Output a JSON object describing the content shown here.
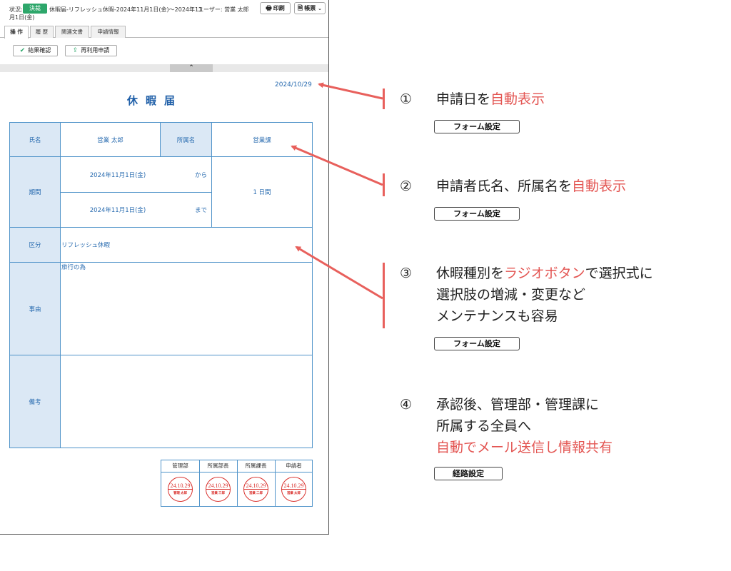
{
  "header": {
    "status_label": "状況:",
    "status_badge": "決裁",
    "subject_line1": "休暇届-リフレッシュ休暇-2024年11月1日(金)〜2024年11",
    "subject_line2": "月1日(金)",
    "user": "ユーザー: 営業 太郎",
    "print_label": "印刷",
    "forms_label": "帳票",
    "print_icon": "printer-icon",
    "forms_icon": "document-icon"
  },
  "tabs": [
    {
      "label": "操 作",
      "active": true
    },
    {
      "label": "履 歴",
      "active": false
    },
    {
      "label": "関連文書",
      "active": false
    },
    {
      "label": "申請情報",
      "active": false
    }
  ],
  "actions": {
    "confirm_label": "結果確認",
    "reapply_label": "再利用申請"
  },
  "form": {
    "date": "2024/10/29",
    "title": "休暇届",
    "name_label": "氏名",
    "name_value": "営業 太郎",
    "dept_label": "所属名",
    "dept_value": "営業課",
    "period_label": "期間",
    "from_date": "2024年11月1日(金)",
    "from_suffix": "から",
    "to_date": "2024年11月1日(金)",
    "to_suffix": "まで",
    "days": "1 日間",
    "type_label": "区分",
    "type_value": "リフレッシュ休暇",
    "reason_label": "事由",
    "reason_value": "旅行の為",
    "notes_label": "備考",
    "notes_value": ""
  },
  "stamps": [
    {
      "header": "管理部",
      "date": "24.10.29",
      "name": "管理 太郎"
    },
    {
      "header": "所属部長",
      "date": "24.10.29",
      "name": "営業 三郎"
    },
    {
      "header": "所属課長",
      "date": "24.10.29",
      "name": "営業 二郎"
    },
    {
      "header": "申請者",
      "date": "24.10.29",
      "name": "営業 太郎"
    }
  ],
  "annotations": [
    {
      "num": "①",
      "lines": [
        [
          "申請日を",
          ""
        ],
        [
          "",
          "自動表示"
        ]
      ],
      "button": "フォーム設定"
    },
    {
      "num": "②",
      "lines": [
        [
          "申請者氏名、所属名を",
          ""
        ],
        [
          "",
          "自動表示"
        ]
      ],
      "button": "フォーム設定"
    },
    {
      "num": "③",
      "parts": [
        "休暇種別を",
        "ラジオボタン",
        "で選択式に"
      ],
      "line2": "選択肢の増減・変更など",
      "line3": "メンテナンスも容易",
      "button": "フォーム設定"
    },
    {
      "num": "④",
      "line1": "承認後、管理部・管理課に",
      "line2": "所属する全員へ",
      "line3": "自動でメール送信し情報共有",
      "button": "経路設定"
    }
  ],
  "colors": {
    "accent": "#1f5fa8",
    "grid": "#4f93c9",
    "label_bg": "#dbe8f5",
    "badge": "#2ea76b",
    "highlight": "#e35552",
    "stamp": "#d9302c"
  }
}
